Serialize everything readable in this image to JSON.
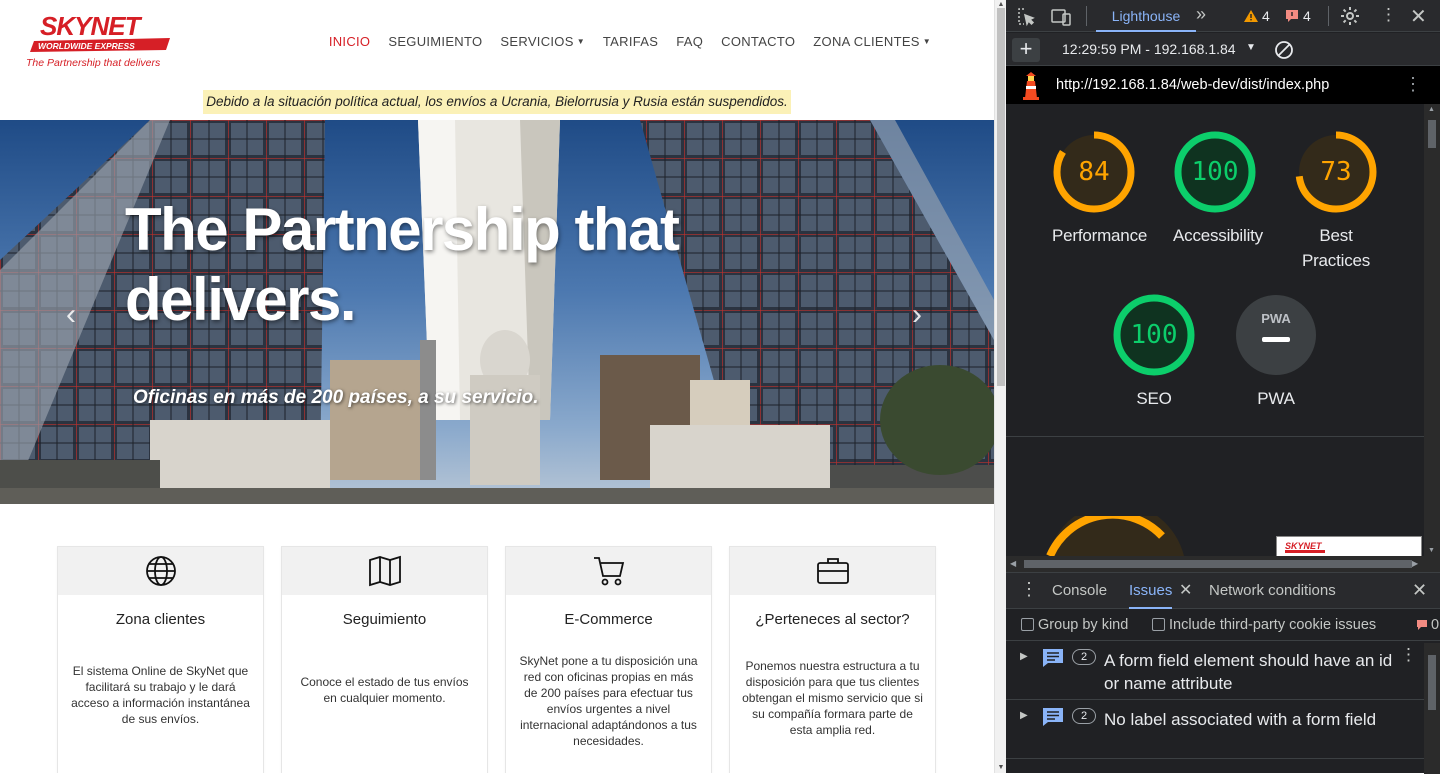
{
  "site": {
    "logo": {
      "brand": "SKYNET",
      "tagline_band": "WORLDWIDE EXPRESS",
      "slogan": "The Partnership that delivers"
    },
    "nav": [
      {
        "label": "INICIO",
        "active": true
      },
      {
        "label": "SEGUIMIENTO"
      },
      {
        "label": "SERVICIOS",
        "dropdown": true
      },
      {
        "label": "TARIFAS"
      },
      {
        "label": "FAQ"
      },
      {
        "label": "CONTACTO"
      },
      {
        "label": "ZONA CLIENTES",
        "dropdown": true
      }
    ],
    "notice": "Debido a la situación política actual, los envíos a Ucrania, Bielorrusia y Rusia están suspendidos.",
    "hero": {
      "title": "The Partnership that delivers.",
      "subtitle": "Oficinas en más de 200 países, a su servicio."
    },
    "cards": [
      {
        "icon": "globe-icon",
        "title": "Zona clientes",
        "text": "El sistema Online de SkyNet que facilitará su trabajo y le dará acceso a información instantánea de sus envíos."
      },
      {
        "icon": "map-icon",
        "title": "Seguimiento",
        "text": "Conoce el estado de tus envíos en cualquier momento."
      },
      {
        "icon": "cart-icon",
        "title": "E-Commerce",
        "text": "SkyNet pone a tu disposición una red con oficinas propias en más de 200 países para efectuar tus envíos urgentes a nivel internacional adaptándonos a tus necesidades."
      },
      {
        "icon": "briefcase-icon",
        "title": "¿Perteneces al sector?",
        "text": "Ponemos nuestra estructura a tu disposición para que tus clientes obtengan el mismo servicio que si su compañía formara parte de esta amplia red."
      }
    ],
    "colors": {
      "brand_red": "#d61f26",
      "notice_bg": "#fbf1b7"
    }
  },
  "devtools": {
    "active_tab": "Lighthouse",
    "warnings": "4",
    "errors": "4",
    "report_selector": "12:29:59 PM - 192.168.1.84",
    "url": "http://192.168.1.84/web-dev/dist/index.php",
    "scores": [
      {
        "label": "Performance",
        "value": "84",
        "fraction": 0.84,
        "color": "#ffa400"
      },
      {
        "label": "Accessibility",
        "value": "100",
        "fraction": 1.0,
        "color": "#0cce6b"
      },
      {
        "label": "Best Practices",
        "value": "73",
        "fraction": 0.73,
        "color": "#ffa400"
      },
      {
        "label": "SEO",
        "value": "100",
        "fraction": 1.0,
        "color": "#0cce6b"
      },
      {
        "label": "PWA",
        "value": "PWA"
      }
    ],
    "drawer": {
      "tabs": [
        "Console",
        "Issues",
        "Network conditions"
      ],
      "active": "Issues",
      "group_by_kind": "Group by kind",
      "third_party": "Include third-party cookie issues",
      "error_count": "0",
      "issues": [
        {
          "count": "2",
          "text": "A form field element should have an id or name attribute"
        },
        {
          "count": "2",
          "text": "No label associated with a form field"
        }
      ]
    }
  }
}
